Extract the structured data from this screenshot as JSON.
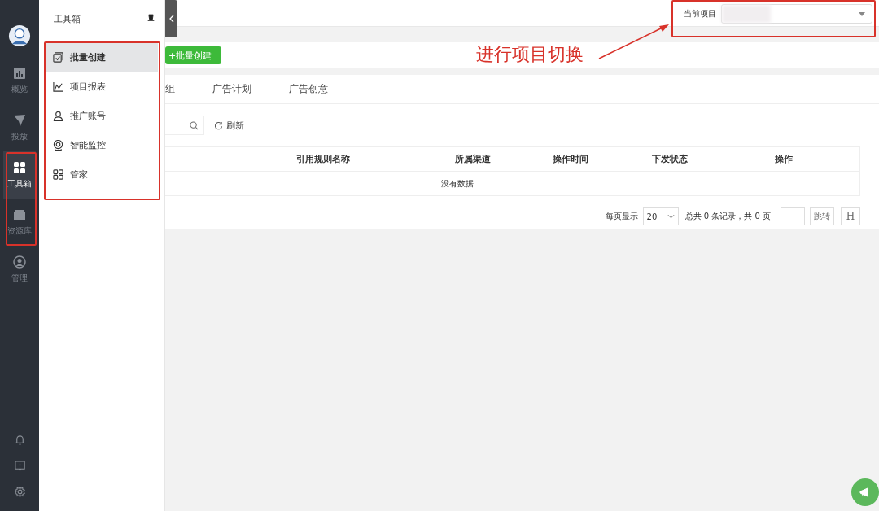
{
  "rail": {
    "items": [
      {
        "label": "概览",
        "selected": false
      },
      {
        "label": "投放",
        "selected": false
      },
      {
        "label": "工具箱",
        "selected": true
      },
      {
        "label": "资源库",
        "selected": false
      },
      {
        "label": "管理",
        "selected": false
      }
    ]
  },
  "drawer": {
    "title": "工具箱",
    "items": [
      {
        "label": "批量创建",
        "selected": true
      },
      {
        "label": "项目报表",
        "selected": false
      },
      {
        "label": "推广账号",
        "selected": false
      },
      {
        "label": "智能监控",
        "selected": false
      },
      {
        "label": "管家",
        "selected": false
      }
    ]
  },
  "topbar": {
    "project_label": "当前项目"
  },
  "create_button": "+批量创建",
  "tabs": [
    {
      "label": "组",
      "selected": false
    },
    {
      "label": "广告计划",
      "selected": false
    },
    {
      "label": "广告创意",
      "selected": false
    }
  ],
  "refresh": "刷新",
  "table": {
    "columns": [
      "引用规则名称",
      "所属渠道",
      "操作时间",
      "下发状态",
      "操作"
    ],
    "empty": "没有数据"
  },
  "pagination": {
    "per_page_label": "每页显示",
    "per_page": "20",
    "summary": "总共 0 条记录，共 0 页",
    "jump": "跳转",
    "last": "H"
  },
  "annotation": "进行项目切换"
}
